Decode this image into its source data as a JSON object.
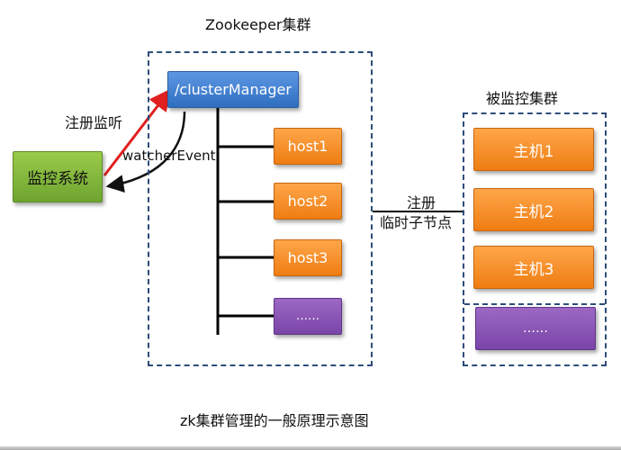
{
  "zk_cluster": {
    "title": "Zookeeper集群",
    "manager_label": "/clusterManager",
    "hosts": [
      "host1",
      "host2",
      "host3",
      "……"
    ]
  },
  "monitor": {
    "label": "监控系统",
    "register_watch_label": "注册监听",
    "event_label": "watcherEvent"
  },
  "monitored_cluster": {
    "title": "被监控集群",
    "hosts": [
      "主机1",
      "主机2",
      "主机3",
      "……"
    ],
    "link_label_line1": "注册",
    "link_label_line2": "临时子节点"
  },
  "caption": "zk集群管理的一般原理示意图",
  "colors": {
    "green_node": "#8bbf3f",
    "blue_node": "#3f7fd0",
    "orange_node": "#f28e23",
    "purple_node": "#8655b3",
    "dashed_border": "#2e4d7a",
    "arrow_red": "#e02020"
  }
}
